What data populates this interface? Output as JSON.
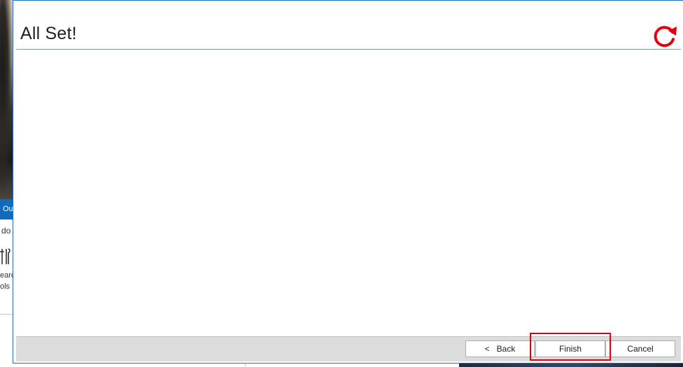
{
  "background": {
    "tab_label": "Ou",
    "text_line": "do",
    "tools_line_1": "earc",
    "tools_line_2": "ols",
    "tools_icon": "tools-icon"
  },
  "dialog": {
    "title": "All Set!",
    "refresh_icon": "refresh-icon",
    "accent_color": "#e0000f",
    "border_color": "#1e6fbf"
  },
  "buttons": {
    "back_chevron": "<",
    "back_label": "Back",
    "finish_label": "Finish",
    "cancel_label": "Cancel"
  },
  "highlight": {
    "target": "finish-button",
    "color": "#e0000f"
  }
}
